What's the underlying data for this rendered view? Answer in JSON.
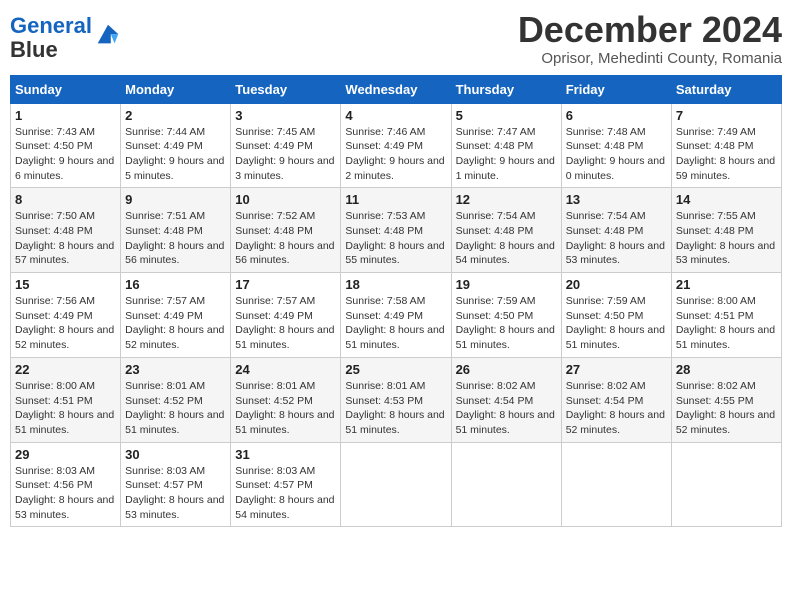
{
  "logo": {
    "line1": "General",
    "line2": "Blue"
  },
  "title": "December 2024",
  "subtitle": "Oprisor, Mehedinti County, Romania",
  "days_of_week": [
    "Sunday",
    "Monday",
    "Tuesday",
    "Wednesday",
    "Thursday",
    "Friday",
    "Saturday"
  ],
  "weeks": [
    [
      {
        "day": "1",
        "sunrise": "7:43 AM",
        "sunset": "4:50 PM",
        "daylight": "9 hours and 6 minutes."
      },
      {
        "day": "2",
        "sunrise": "7:44 AM",
        "sunset": "4:49 PM",
        "daylight": "9 hours and 5 minutes."
      },
      {
        "day": "3",
        "sunrise": "7:45 AM",
        "sunset": "4:49 PM",
        "daylight": "9 hours and 3 minutes."
      },
      {
        "day": "4",
        "sunrise": "7:46 AM",
        "sunset": "4:49 PM",
        "daylight": "9 hours and 2 minutes."
      },
      {
        "day": "5",
        "sunrise": "7:47 AM",
        "sunset": "4:48 PM",
        "daylight": "9 hours and 1 minute."
      },
      {
        "day": "6",
        "sunrise": "7:48 AM",
        "sunset": "4:48 PM",
        "daylight": "9 hours and 0 minutes."
      },
      {
        "day": "7",
        "sunrise": "7:49 AM",
        "sunset": "4:48 PM",
        "daylight": "8 hours and 59 minutes."
      }
    ],
    [
      {
        "day": "8",
        "sunrise": "7:50 AM",
        "sunset": "4:48 PM",
        "daylight": "8 hours and 57 minutes."
      },
      {
        "day": "9",
        "sunrise": "7:51 AM",
        "sunset": "4:48 PM",
        "daylight": "8 hours and 56 minutes."
      },
      {
        "day": "10",
        "sunrise": "7:52 AM",
        "sunset": "4:48 PM",
        "daylight": "8 hours and 56 minutes."
      },
      {
        "day": "11",
        "sunrise": "7:53 AM",
        "sunset": "4:48 PM",
        "daylight": "8 hours and 55 minutes."
      },
      {
        "day": "12",
        "sunrise": "7:54 AM",
        "sunset": "4:48 PM",
        "daylight": "8 hours and 54 minutes."
      },
      {
        "day": "13",
        "sunrise": "7:54 AM",
        "sunset": "4:48 PM",
        "daylight": "8 hours and 53 minutes."
      },
      {
        "day": "14",
        "sunrise": "7:55 AM",
        "sunset": "4:48 PM",
        "daylight": "8 hours and 53 minutes."
      }
    ],
    [
      {
        "day": "15",
        "sunrise": "7:56 AM",
        "sunset": "4:49 PM",
        "daylight": "8 hours and 52 minutes."
      },
      {
        "day": "16",
        "sunrise": "7:57 AM",
        "sunset": "4:49 PM",
        "daylight": "8 hours and 52 minutes."
      },
      {
        "day": "17",
        "sunrise": "7:57 AM",
        "sunset": "4:49 PM",
        "daylight": "8 hours and 51 minutes."
      },
      {
        "day": "18",
        "sunrise": "7:58 AM",
        "sunset": "4:49 PM",
        "daylight": "8 hours and 51 minutes."
      },
      {
        "day": "19",
        "sunrise": "7:59 AM",
        "sunset": "4:50 PM",
        "daylight": "8 hours and 51 minutes."
      },
      {
        "day": "20",
        "sunrise": "7:59 AM",
        "sunset": "4:50 PM",
        "daylight": "8 hours and 51 minutes."
      },
      {
        "day": "21",
        "sunrise": "8:00 AM",
        "sunset": "4:51 PM",
        "daylight": "8 hours and 51 minutes."
      }
    ],
    [
      {
        "day": "22",
        "sunrise": "8:00 AM",
        "sunset": "4:51 PM",
        "daylight": "8 hours and 51 minutes."
      },
      {
        "day": "23",
        "sunrise": "8:01 AM",
        "sunset": "4:52 PM",
        "daylight": "8 hours and 51 minutes."
      },
      {
        "day": "24",
        "sunrise": "8:01 AM",
        "sunset": "4:52 PM",
        "daylight": "8 hours and 51 minutes."
      },
      {
        "day": "25",
        "sunrise": "8:01 AM",
        "sunset": "4:53 PM",
        "daylight": "8 hours and 51 minutes."
      },
      {
        "day": "26",
        "sunrise": "8:02 AM",
        "sunset": "4:54 PM",
        "daylight": "8 hours and 51 minutes."
      },
      {
        "day": "27",
        "sunrise": "8:02 AM",
        "sunset": "4:54 PM",
        "daylight": "8 hours and 52 minutes."
      },
      {
        "day": "28",
        "sunrise": "8:02 AM",
        "sunset": "4:55 PM",
        "daylight": "8 hours and 52 minutes."
      }
    ],
    [
      {
        "day": "29",
        "sunrise": "8:03 AM",
        "sunset": "4:56 PM",
        "daylight": "8 hours and 53 minutes."
      },
      {
        "day": "30",
        "sunrise": "8:03 AM",
        "sunset": "4:57 PM",
        "daylight": "8 hours and 53 minutes."
      },
      {
        "day": "31",
        "sunrise": "8:03 AM",
        "sunset": "4:57 PM",
        "daylight": "8 hours and 54 minutes."
      },
      null,
      null,
      null,
      null
    ]
  ]
}
